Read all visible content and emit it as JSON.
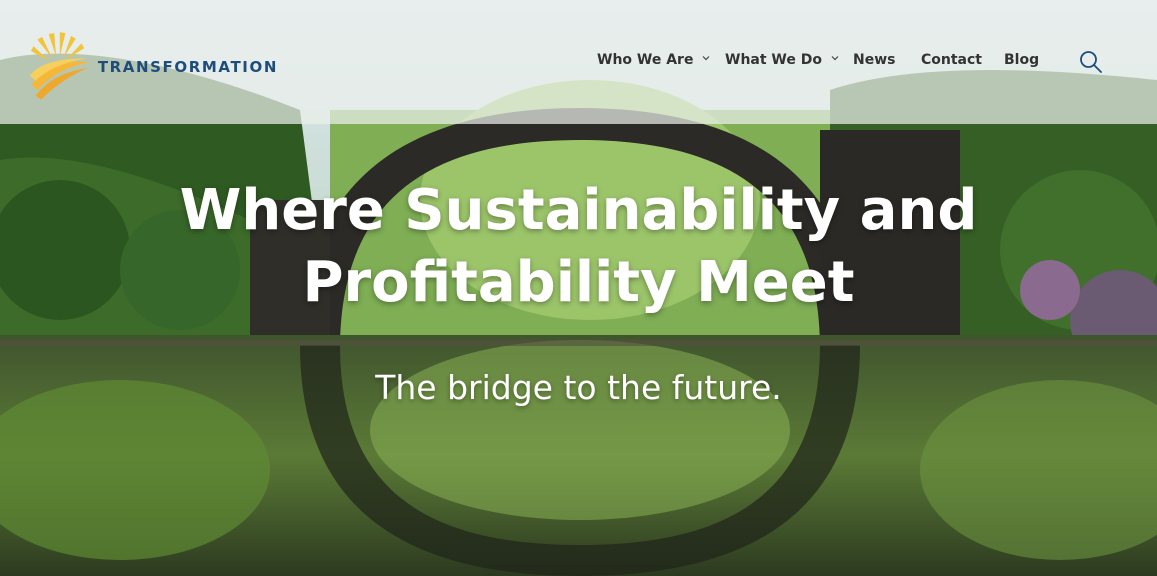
{
  "brand": {
    "name": "TRANSFORMATION",
    "logo_icon": "sunburst-logo-icon",
    "colors": {
      "text": "#1f4d7a",
      "sun": "#f2c43a"
    }
  },
  "nav": {
    "items": [
      {
        "label": "Who We Are",
        "has_dropdown": true
      },
      {
        "label": "What We Do",
        "has_dropdown": true
      },
      {
        "label": "News",
        "has_dropdown": false
      },
      {
        "label": "Contact",
        "has_dropdown": false
      },
      {
        "label": "Blog",
        "has_dropdown": false
      }
    ],
    "search_icon": "search-icon"
  },
  "hero": {
    "headline_line1": "Where Sustainability and",
    "headline_line2": "Profitability Meet",
    "subheadline": "The bridge to the future."
  }
}
